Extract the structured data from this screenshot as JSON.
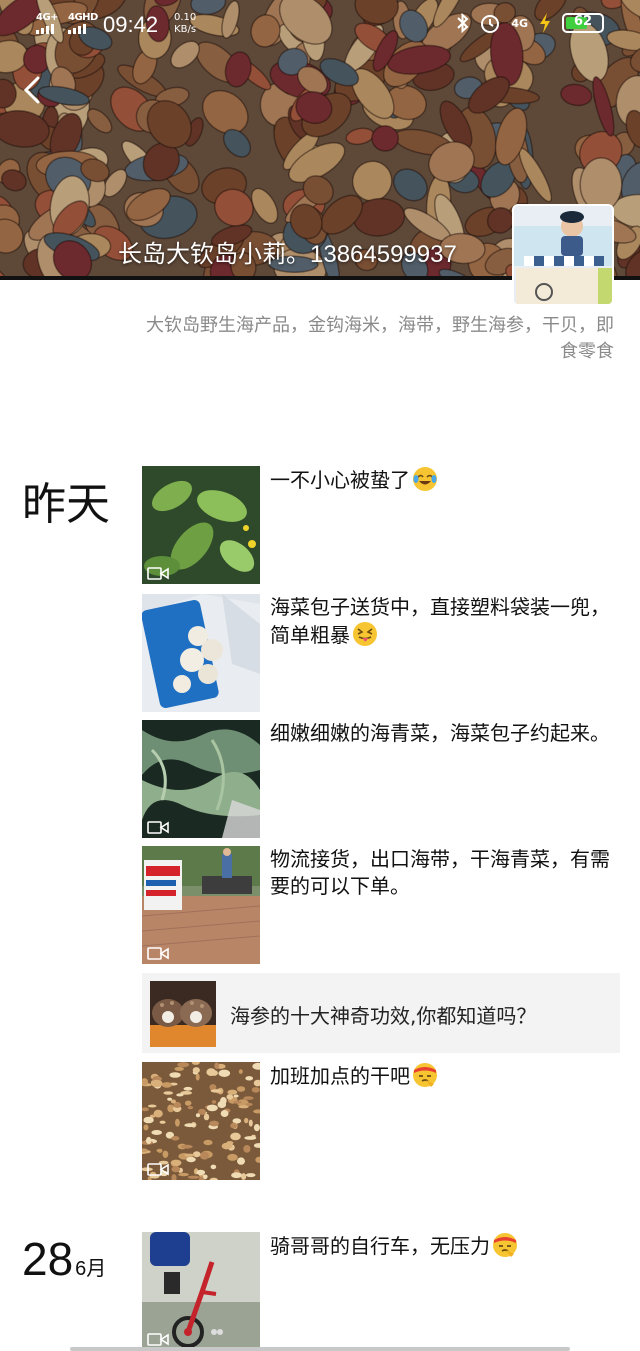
{
  "status_bar": {
    "net1": "4G+",
    "net2": "4GHD",
    "time": "09:42",
    "speed_value": "0.10",
    "speed_unit": "KB/s",
    "net3": "4G",
    "battery": "62"
  },
  "profile": {
    "name": "长岛大钦岛小莉。13864599937",
    "signature": "大钦岛野生海产品，金钩海米，海带，野生海参，干贝，即食零食"
  },
  "feed": {
    "day_yesterday": "昨天",
    "date_day": "28",
    "date_month": "6月",
    "posts": [
      {
        "text": "一不小心被蛰了",
        "emoji": "laughing-crying-emoji",
        "video": true
      },
      {
        "text": "海菜包子送货中，直接塑料袋装一兜，简单粗暴",
        "emoji": "tongue-emoji",
        "video": false
      },
      {
        "text": "细嫩细嫩的海青菜，海菜包子约起来。",
        "emoji": "",
        "video": true
      },
      {
        "text": "物流接货，出口海带，干海青菜，有需要的可以下单。",
        "emoji": "",
        "video": true
      },
      {
        "text": "加班加点的干吧",
        "emoji": "headband-emoji",
        "video": true
      },
      {
        "text": "骑哥哥的自行车，无压力",
        "emoji": "headband-emoji",
        "video": true
      }
    ],
    "shared_article": {
      "title": "海参的十大神奇功效,你都知道吗？"
    }
  },
  "colors": {
    "signature_gray": "#8a8a8a",
    "share_bg": "#f3f3f3",
    "battery_green": "#3fcf3f"
  }
}
